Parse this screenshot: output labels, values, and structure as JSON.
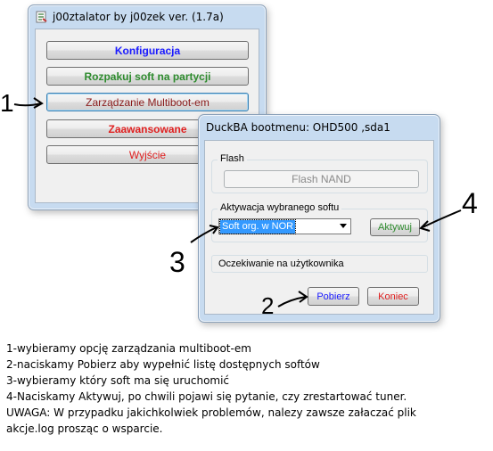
{
  "main_window": {
    "title": "j00ztalator by j00zek ver. (1.7a)",
    "buttons": {
      "konfiguracja": "Konfiguracja",
      "rozpakuj": "Rozpakuj soft na partycji",
      "zarzadzanie": "Zarządzanie Multiboot-em",
      "zaawansowane": "Zaawansowane",
      "wyjscie": "Wyjście"
    }
  },
  "dialog": {
    "title": "DuckBA bootmenu: OHD500 ,sda1",
    "flash_group": {
      "legend": "Flash",
      "button": "Flash NAND"
    },
    "soft_group": {
      "legend": "Aktywacja wybranego softu",
      "selected": "Soft org. w NOR",
      "activate_button": "Aktywuj"
    },
    "status": "Oczekiwanie na użytkownika",
    "fetch_button": "Pobierz",
    "end_button": "Koniec"
  },
  "annotations": {
    "a1": "1",
    "a2": "2",
    "a3": "3",
    "a4": "4"
  },
  "instructions": [
    "1-wybieramy opcję zarządzania multiboot-em",
    "2-naciskamy Pobierz aby wypełnić listę dostępnych softów",
    "3-wybieramy który soft ma się uruchomić",
    "4-Naciskamy Aktywuj, po chwili pojawi się pytanie, czy zrestartować tuner.",
    "UWAGA: W przypadku jakichkolwiek problemów, nalezy zawsze załaczać plik",
    "akcje.log prosząc o wsparcie."
  ],
  "colors": {
    "blue_text": "#1a1aff",
    "green_text": "#2e8b2e",
    "red_text": "#e02020",
    "dark_red_text": "#8a1a1a",
    "window_frame": "#c7dbf0",
    "selection": "#3399ff"
  },
  "icons": [
    "app-icon",
    "dropdown-arrow-icon"
  ]
}
